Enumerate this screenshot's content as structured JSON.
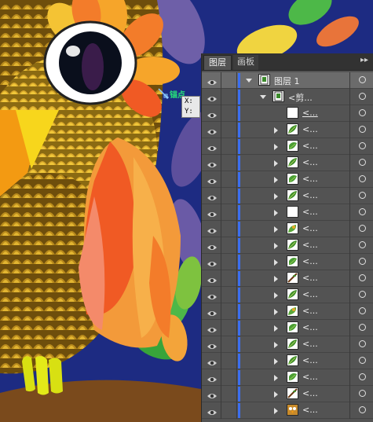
{
  "canvas": {
    "anchor_label": "锚点",
    "xy_tooltip": {
      "x": "X:",
      "y": "Y:"
    }
  },
  "panel": {
    "tabs": [
      {
        "label": "图层",
        "active": true
      },
      {
        "label": "画板",
        "active": false
      }
    ],
    "menu_icon": "panel-menu-icon",
    "accent_color": "#3c6ff0",
    "layers": [
      {
        "label": "图层 1",
        "kind": "layer",
        "expanded": true,
        "thumb": "layer"
      },
      {
        "label": "<剪...",
        "kind": "clip-group",
        "expanded": true,
        "thumb": "layer"
      },
      {
        "label": "<...",
        "kind": "clip-path",
        "thumb": "white"
      },
      {
        "label": "<...",
        "kind": "group",
        "thumb": "leaf"
      },
      {
        "label": "<...",
        "kind": "group",
        "thumb": "leaf2"
      },
      {
        "label": "<...",
        "kind": "group",
        "thumb": "leaf"
      },
      {
        "label": "<...",
        "kind": "group",
        "thumb": "leaf2"
      },
      {
        "label": "<...",
        "kind": "group",
        "thumb": "leaf"
      },
      {
        "label": "<...",
        "kind": "group",
        "thumb": "white"
      },
      {
        "label": "<...",
        "kind": "group",
        "thumb": "leaf3"
      },
      {
        "label": "<...",
        "kind": "group",
        "thumb": "leaf"
      },
      {
        "label": "<...",
        "kind": "group",
        "thumb": "leaf2"
      },
      {
        "label": "<...",
        "kind": "group",
        "thumb": "branch"
      },
      {
        "label": "<...",
        "kind": "group",
        "thumb": "leaf"
      },
      {
        "label": "<...",
        "kind": "group",
        "thumb": "leaf3"
      },
      {
        "label": "<...",
        "kind": "group",
        "thumb": "leaf2"
      },
      {
        "label": "<...",
        "kind": "group",
        "thumb": "leaf"
      },
      {
        "label": "<...",
        "kind": "group",
        "thumb": "leaf"
      },
      {
        "label": "<...",
        "kind": "group",
        "thumb": "leaf2"
      },
      {
        "label": "<...",
        "kind": "group",
        "thumb": "branch"
      },
      {
        "label": "<...",
        "kind": "group",
        "thumb": "owl"
      }
    ]
  }
}
